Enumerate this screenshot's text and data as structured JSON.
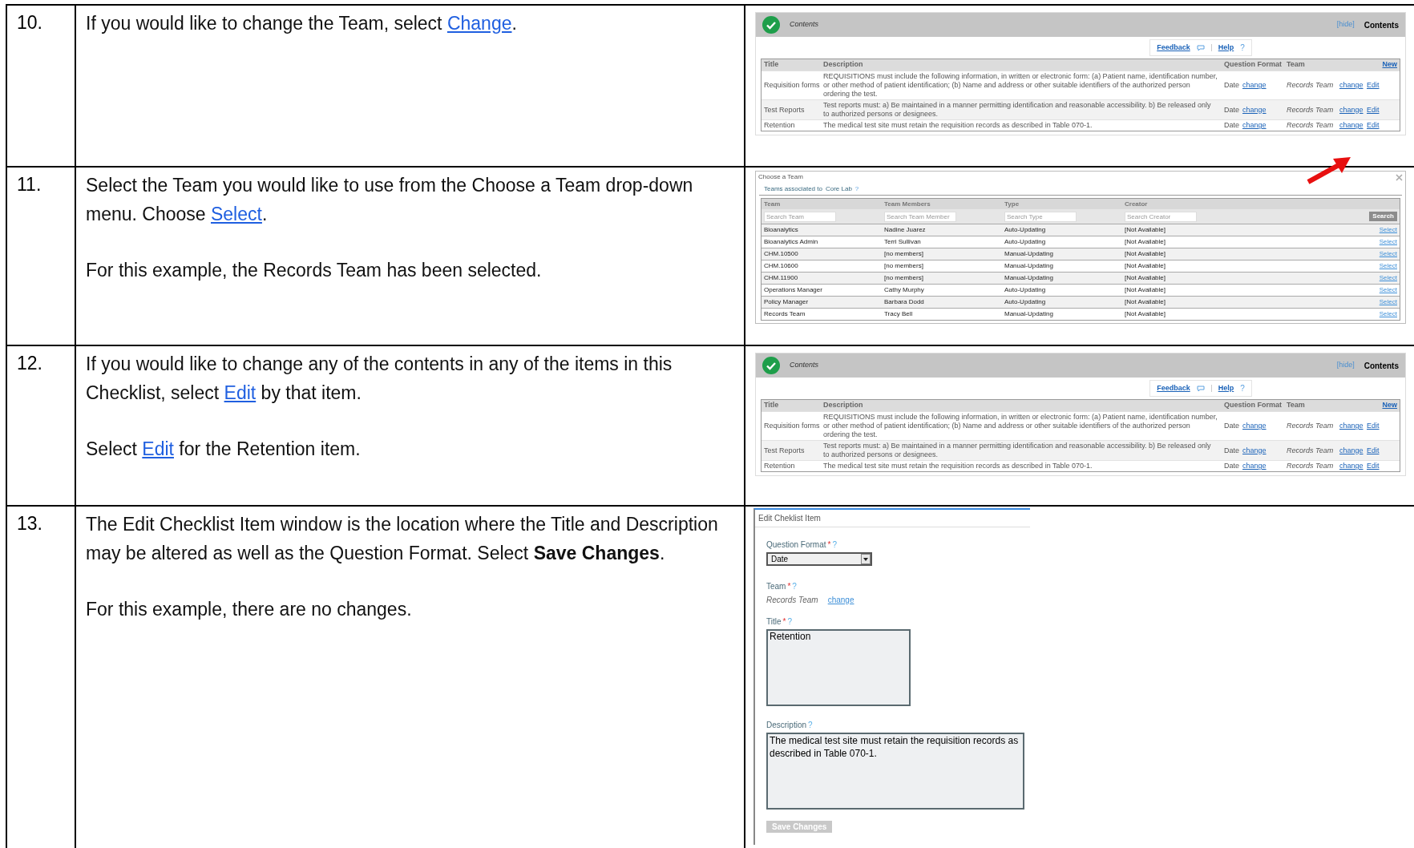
{
  "steps": [
    {
      "number": "10.",
      "paragraphs": [
        [
          {
            "kind": "text",
            "text": "If you would like to change the Team, select "
          },
          {
            "kind": "link",
            "text": "Change"
          },
          {
            "kind": "text",
            "text": "."
          }
        ]
      ],
      "screenshot": {
        "kind": "checklist",
        "header_title": "Contents",
        "hide_link": "[hide]",
        "header_right": "Contents",
        "feedback": "Feedback",
        "help": "Help",
        "help_mark": "?",
        "columns": [
          "Title",
          "Description",
          "Question Format",
          "Team"
        ],
        "new_link": "New",
        "rows": [
          {
            "title": "Requisition forms",
            "description": "REQUISITIONS must include the following information, in written or electronic form: (a) Patient name, identification number, or other method of patient identification; (b) Name and address or other suitable identifiers of the authorized person ordering the test.",
            "format": "Date",
            "format_link": "change",
            "team": "Records Team",
            "team_link": "change",
            "edit": "Edit"
          },
          {
            "title": "Test Reports",
            "description": "Test reports must: a) Be maintained in a manner permitting identification and reasonable accessibility. b) Be released only to authorized persons or designees.",
            "format": "Date",
            "format_link": "change",
            "team": "Records Team",
            "team_link": "change",
            "edit": "Edit"
          },
          {
            "title": "Retention",
            "description": "The medical test site must retain the requisition records as described in Table 070-1.",
            "format": "Date",
            "format_link": "change",
            "team": "Records Team",
            "team_link": "change",
            "edit": "Edit"
          }
        ]
      }
    },
    {
      "number": "11.",
      "paragraphs": [
        [
          {
            "kind": "text",
            "text": "Select the Team you would like to use from the Choose a Team drop-down menu. Choose "
          },
          {
            "kind": "link",
            "text": "Select"
          },
          {
            "kind": "text",
            "text": "."
          }
        ],
        [
          {
            "kind": "text",
            "text": "For this example, the Records Team has been selected."
          }
        ]
      ],
      "screenshot": {
        "kind": "team_picker",
        "title": "Choose a Team",
        "subtitle": "Teams associated to",
        "site": "Core Lab",
        "help_mark": "?",
        "columns": [
          "Team",
          "Team Members",
          "Type",
          "Creator"
        ],
        "search_placeholders": [
          "Search Team",
          "Search Team Member",
          "Search Type",
          "Search Creator"
        ],
        "search_button": "Search",
        "rows": [
          {
            "team": "Bioanalytics",
            "members": "Nadine Juarez",
            "type": "Auto-Updating",
            "creator": "[Not Available]",
            "action": "Select"
          },
          {
            "team": "Bioanalytics Admin",
            "members": "Terri Sullivan",
            "type": "Auto-Updating",
            "creator": "[Not Available]",
            "action": "Select"
          },
          {
            "team": "CHM.10500",
            "members": "[no members]",
            "type": "Manual-Updating",
            "creator": "[Not Available]",
            "action": "Select"
          },
          {
            "team": "CHM.10600",
            "members": "[no members]",
            "type": "Manual-Updating",
            "creator": "[Not Available]",
            "action": "Select"
          },
          {
            "team": "CHM.11900",
            "members": "[no members]",
            "type": "Manual-Updating",
            "creator": "[Not Available]",
            "action": "Select"
          },
          {
            "team": "Operations Manager",
            "members": "Cathy Murphy",
            "type": "Auto-Updating",
            "creator": "[Not Available]",
            "action": "Select"
          },
          {
            "team": "Policy Manager",
            "members": "Barbara Dodd",
            "type": "Auto-Updating",
            "creator": "[Not Available]",
            "action": "Select"
          },
          {
            "team": "Records Team",
            "members": "Tracy Bell",
            "type": "Manual-Updating",
            "creator": "[Not Available]",
            "action": "Select"
          }
        ]
      }
    },
    {
      "number": "12.",
      "paragraphs": [
        [
          {
            "kind": "text",
            "text": "If you would like to change any of the contents in any of the items in this Checklist, select "
          },
          {
            "kind": "link",
            "text": "Edit"
          },
          {
            "kind": "text",
            "text": " by that item."
          }
        ],
        [
          {
            "kind": "text",
            "text": "Select "
          },
          {
            "kind": "link",
            "text": "Edit"
          },
          {
            "kind": "text",
            "text": " for the Retention item."
          }
        ]
      ],
      "screenshot": {
        "kind": "checklist",
        "header_title": "Contents",
        "hide_link": "[hide]",
        "header_right": "Contents",
        "feedback": "Feedback",
        "help": "Help",
        "help_mark": "?",
        "columns": [
          "Title",
          "Description",
          "Question Format",
          "Team"
        ],
        "new_link": "New",
        "rows": [
          {
            "title": "Requisition forms",
            "description": "REQUISITIONS must include the following information, in written or electronic form: (a) Patient name, identification number, or other method of patient identification; (b) Name and address or other suitable identifiers of the authorized person ordering the test.",
            "format": "Date",
            "format_link": "change",
            "team": "Records Team",
            "team_link": "change",
            "edit": "Edit"
          },
          {
            "title": "Test Reports",
            "description": "Test reports must: a) Be maintained in a manner permitting identification and reasonable accessibility. b) Be released only to authorized persons or designees.",
            "format": "Date",
            "format_link": "change",
            "team": "Records Team",
            "team_link": "change",
            "edit": "Edit"
          },
          {
            "title": "Retention",
            "description": "The medical test site must retain the requisition records as described in Table 070-1.",
            "format": "Date",
            "format_link": "change",
            "team": "Records Team",
            "team_link": "change",
            "edit": "Edit"
          }
        ]
      }
    },
    {
      "number": "13.",
      "paragraphs": [
        [
          {
            "kind": "text",
            "text": "The Edit Checklist Item window is the location where the Title and Description may be altered as well as the Question Format.  Select "
          },
          {
            "kind": "bold",
            "text": "Save Changes"
          },
          {
            "kind": "text",
            "text": "."
          }
        ],
        [
          {
            "kind": "text",
            "text": "For this example, there are no changes."
          }
        ]
      ],
      "screenshot": {
        "kind": "edit_item",
        "title": "Edit Cheklist Item",
        "required_mark": "*",
        "help_mark": "?",
        "format_label": "Question Format",
        "format_value": "Date",
        "team_label": "Team",
        "team_value": "Records Team",
        "team_link": "change",
        "title_label": "Title",
        "title_value": "Retention",
        "description_label": "Description",
        "description_value": "The medical test site must retain the requisition records as described in Table 070-1.",
        "save_button": "Save Changes",
        "save_disabled": true
      }
    }
  ]
}
